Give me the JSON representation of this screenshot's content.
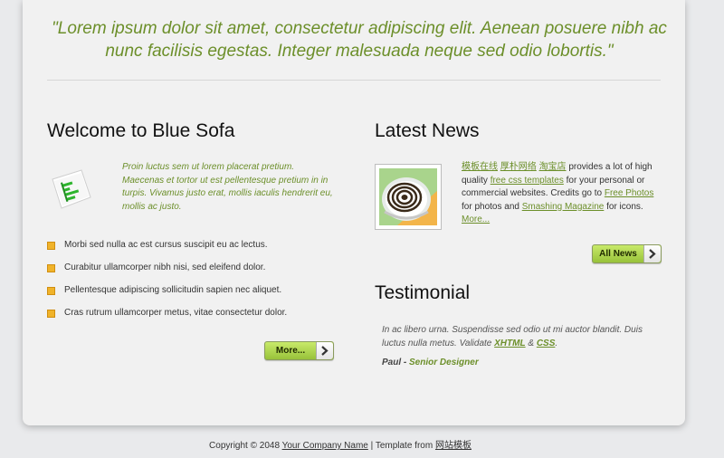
{
  "quote": "\"Lorem ipsum dolor sit amet, consectetur adipiscing elit. Aenean posuere nibh ac nunc facilisis egestas. Integer malesuada neque sed odio lobortis.\"",
  "welcome": {
    "title": "Welcome to Blue Sofa",
    "intro": "Proin luctus sem ut lorem placerat pretium. Maecenas et tortor ut est pellentesque pretium in in turpis. Vivamus justo erat, mollis iaculis hendrerit eu, mollis ac justo.",
    "bullets": [
      "Morbi sed nulla ac est cursus suscipit eu ac lectus.",
      "Curabitur ullamcorper nibh nisi, sed eleifend dolor.",
      "Pellentesque adipiscing sollicitudin sapien nec aliquet.",
      "Cras rutrum ullamcorper metus, vitae consectetur dolor."
    ],
    "more_label": "More..."
  },
  "news": {
    "title": "Latest News",
    "link1": "模板在线",
    "link2": "厚朴网络",
    "link3": "淘宝店",
    "text1": " provides a lot of high quality ",
    "link4": "free css templates",
    "text2": " for your personal or commercial websites. Credits go to ",
    "link5": "Free Photos",
    "text3": " for photos and ",
    "link6": "Smashing Magazine",
    "text4": " for icons.",
    "more_link": "More...",
    "button_label": "All News"
  },
  "testimonial": {
    "title": "Testimonial",
    "text": "In ac libero urna. Suspendisse sed odio ut mi auctor blandit. Duis luctus nulla metus. Validate ",
    "link_xhtml": "XHTML",
    "amp": " & ",
    "link_css": "CSS",
    "period": ".",
    "author": "Paul - ",
    "role": "Senior Designer"
  },
  "footer": {
    "copyright": "Copyright © 2048 ",
    "company": "Your Company Name",
    "sep": " | Template from ",
    "template_link": "网站模板"
  },
  "colors": {
    "accent_green": "#6c8f2a",
    "bullet": "#f0b32a",
    "button_green": "#a8d14a"
  },
  "icons": [
    "document-chart-icon",
    "bullet-square-icon",
    "arrow-right-icon",
    "news-thumbnail"
  ]
}
